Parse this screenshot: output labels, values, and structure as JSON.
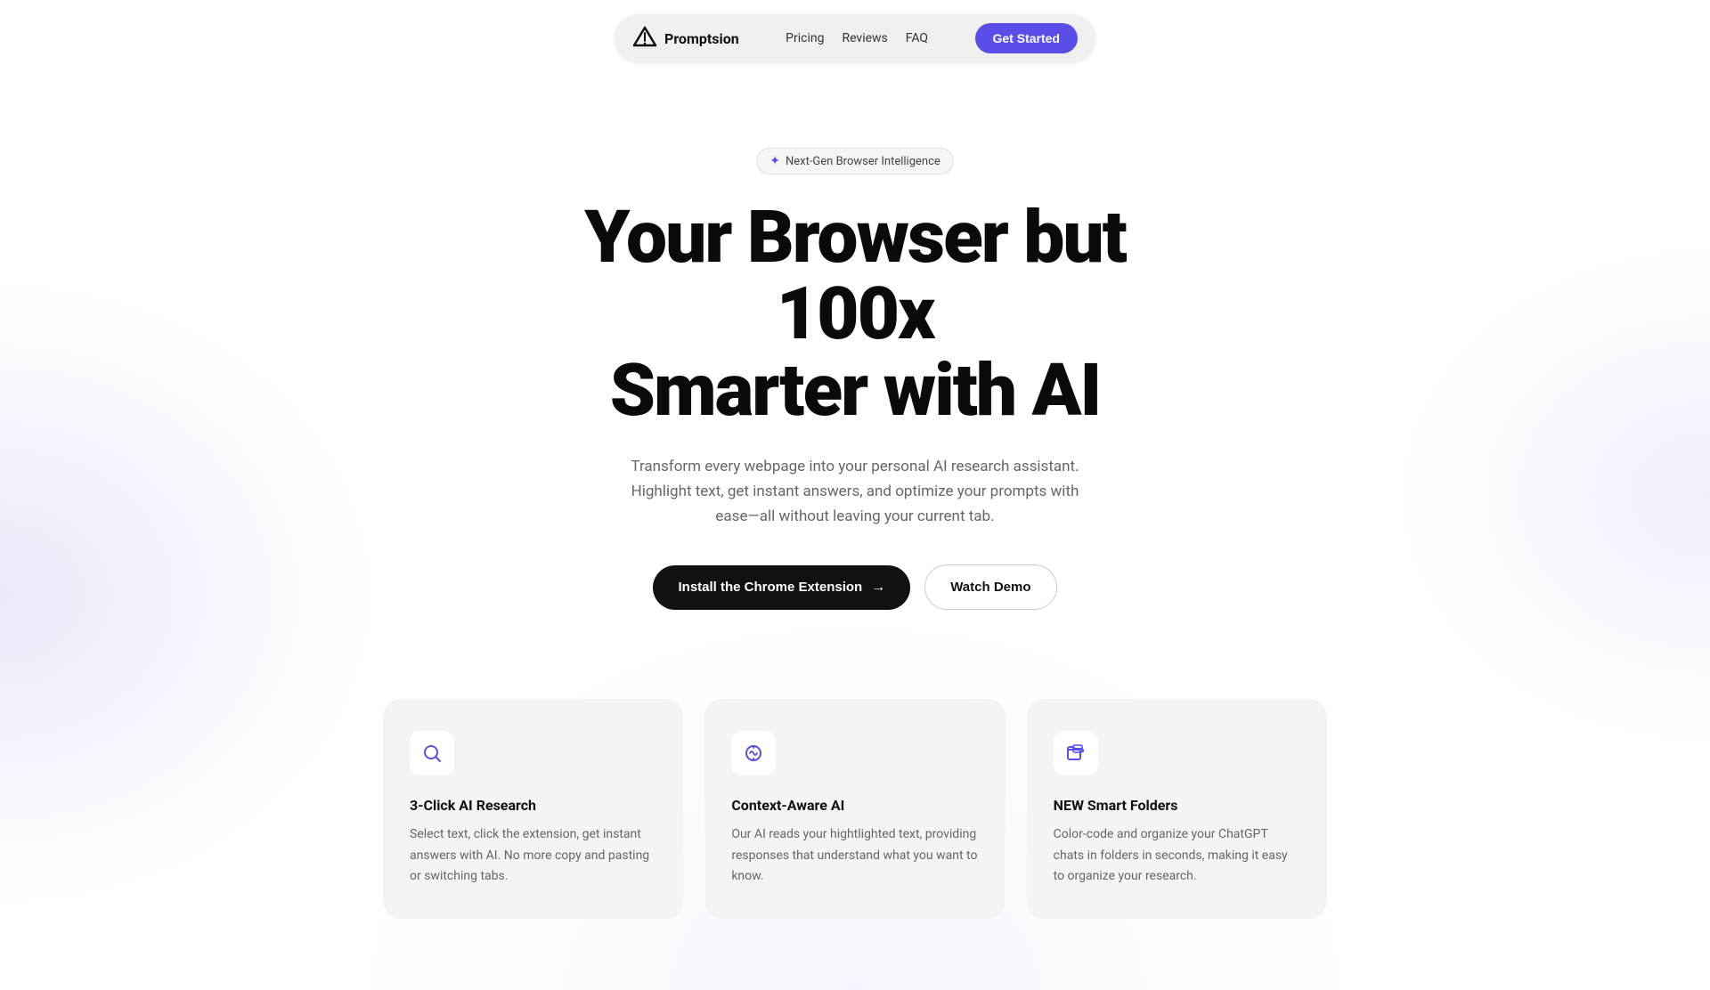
{
  "nav": {
    "logo_text": "Promptsion",
    "links": [
      {
        "label": "Pricing",
        "id": "pricing"
      },
      {
        "label": "Reviews",
        "id": "reviews"
      },
      {
        "label": "FAQ",
        "id": "faq"
      }
    ],
    "cta_label": "Get Started"
  },
  "hero": {
    "badge_text": "Next-Gen Browser Intelligence",
    "title_line1": "Your Browser but 100x",
    "title_line2": "Smarter with AI",
    "subtitle": "Transform every webpage into your personal AI research assistant. Highlight text, get instant answers, and optimize your prompts with ease—all without leaving your current tab.",
    "btn_primary_label": "Install the Chrome Extension",
    "btn_secondary_label": "Watch Demo"
  },
  "cards": [
    {
      "title": "3-Click AI Research",
      "description": "Select text, click the extension, get instant answers with AI. No more copy and pasting or switching tabs.",
      "icon": "search"
    },
    {
      "title": "Context-Aware AI",
      "description": "Our AI reads your hightlighted text, providing responses that understand what you want to know.",
      "icon": "brain"
    },
    {
      "title": "NEW Smart Folders",
      "description": "Color-code and organize your ChatGPT chats in folders in seconds, making it easy to organize your research.",
      "icon": "folders"
    }
  ]
}
